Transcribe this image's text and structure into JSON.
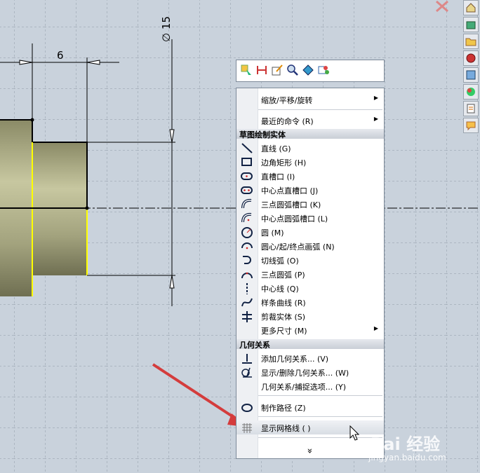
{
  "drawing": {
    "dimension_width": "6",
    "dimension_diameter": "∅ 15"
  },
  "toolbar": {
    "icons": [
      "select-icon",
      "smart-dimension-icon",
      "sketch-icon",
      "zoom-icon",
      "view-orientation-icon",
      "edit-appearance-icon"
    ]
  },
  "menu": {
    "items_top": [
      {
        "label": "缩放/平移/旋转",
        "submenu": true
      },
      {
        "label": "最近的命令 (R)",
        "submenu": true
      }
    ],
    "section_sketch": "草图绘制实体",
    "sketch_items": [
      {
        "label": "直线 (G)"
      },
      {
        "label": "边角矩形 (H)"
      },
      {
        "label": "直槽口 (I)"
      },
      {
        "label": "中心点直槽口 (J)"
      },
      {
        "label": "三点圆弧槽口 (K)"
      },
      {
        "label": "中心点圆弧槽口 (L)"
      },
      {
        "label": "圆 (M)"
      },
      {
        "label": "圆心/起/终点画弧 (N)"
      },
      {
        "label": "切线弧 (O)"
      },
      {
        "label": "三点圆弧 (P)"
      },
      {
        "label": "中心线 (Q)"
      },
      {
        "label": "样条曲线 (R)"
      },
      {
        "label": "剪裁实体 (S)"
      },
      {
        "label": "更多尺寸 (M)",
        "submenu": true
      }
    ],
    "section_relations": "几何关系",
    "relation_items": [
      {
        "label": "添加几何关系... (V)"
      },
      {
        "label": "显示/删除几何关系... (W)"
      },
      {
        "label": "几何关系/捕捉选项... (Y)"
      }
    ],
    "path_item": "制作路径 (Z)",
    "grid_item": "显示网格线 ( )",
    "expand": "»"
  },
  "watermark": {
    "brand": "Bai 经验",
    "url": "jingyan.baidu.com"
  },
  "colors": {
    "canvas_bg": "#c9d2dc",
    "part_face": "#b3b38c",
    "highlight_edge": "#ffff00",
    "arrow": "#d43c3c"
  }
}
